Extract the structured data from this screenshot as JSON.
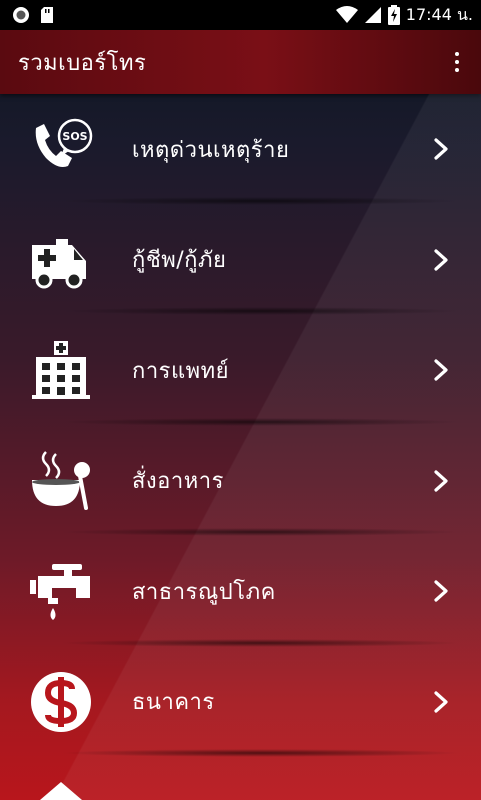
{
  "status_bar": {
    "time": "17:44 น.",
    "icons": [
      "record-icon",
      "sd-card-icon",
      "wifi-icon",
      "signal-icon",
      "battery-charging-icon"
    ]
  },
  "appbar": {
    "title": "รวมเบอร์โทร",
    "overflow_icon": "more-vert-icon"
  },
  "menu": [
    {
      "label": "เหตุด่วนเหตุร้าย",
      "icon": "phone-sos-icon"
    },
    {
      "label": "กู้ชีพ/กู้ภัย",
      "icon": "ambulance-icon"
    },
    {
      "label": "การแพทย์",
      "icon": "hospital-icon"
    },
    {
      "label": "สั่งอาหาร",
      "icon": "food-bowl-icon"
    },
    {
      "label": "สาธารณูปโภค",
      "icon": "water-tap-icon"
    },
    {
      "label": "ธนาคาร",
      "icon": "dollar-coin-icon"
    }
  ],
  "colors": {
    "appbar": "#7a0f16",
    "status_bar": "#000000",
    "text": "#ffffff",
    "bottom_red": "#b8161c"
  }
}
